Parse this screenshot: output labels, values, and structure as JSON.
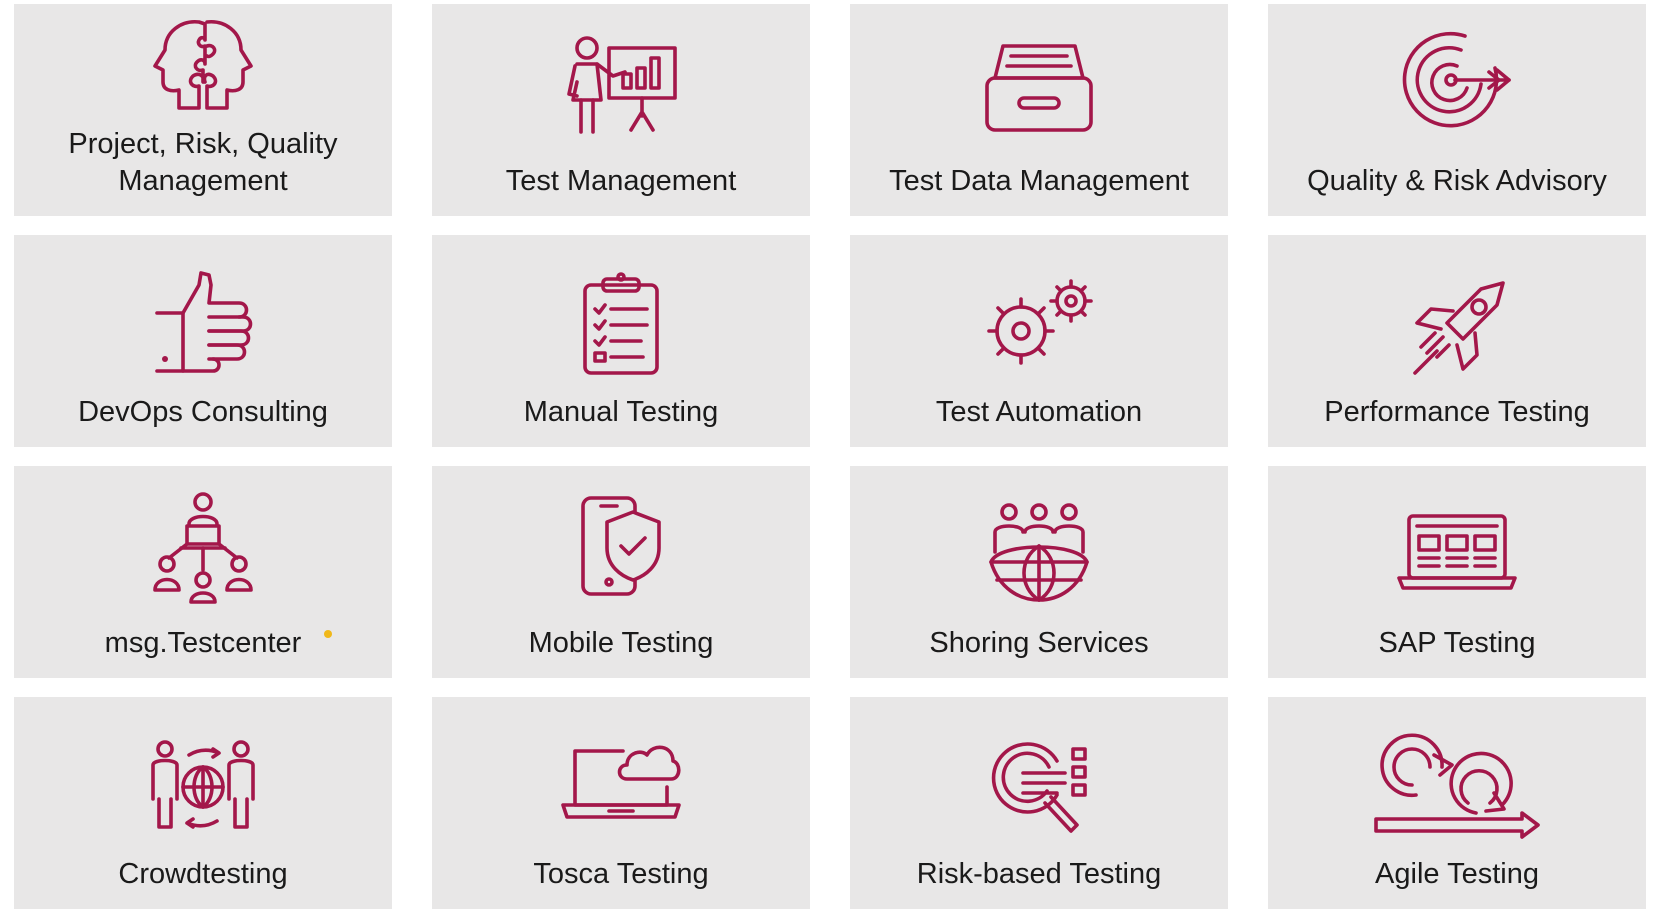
{
  "tiles": [
    {
      "label": "Project, Risk, Quality\nManagement",
      "icon": "puzzle-heads-icon"
    },
    {
      "label": "Test Management",
      "icon": "presenter-chart-icon"
    },
    {
      "label": "Test Data Management",
      "icon": "archive-drawer-icon"
    },
    {
      "label": "Quality & Risk Advisory",
      "icon": "target-arrow-icon"
    },
    {
      "label": "DevOps Consulting",
      "icon": "thumbs-up-icon"
    },
    {
      "label": "Manual Testing",
      "icon": "clipboard-checklist-icon"
    },
    {
      "label": "Test Automation",
      "icon": "gears-icon"
    },
    {
      "label": "Performance Testing",
      "icon": "rocket-icon"
    },
    {
      "label": "msg.Testcenter",
      "icon": "team-network-icon"
    },
    {
      "label": "Mobile Testing",
      "icon": "phone-shield-icon"
    },
    {
      "label": "Shoring Services",
      "icon": "people-globe-icon"
    },
    {
      "label": "SAP Testing",
      "icon": "laptop-icon"
    },
    {
      "label": "Crowdtesting",
      "icon": "people-globe-exchange-icon"
    },
    {
      "label": "Tosca Testing",
      "icon": "laptop-cloud-icon"
    },
    {
      "label": "Risk-based Testing",
      "icon": "magnifier-list-icon"
    },
    {
      "label": "Agile Testing",
      "icon": "agile-cycle-icon"
    }
  ],
  "colors": {
    "accent": "#a3174a",
    "tile_bg": "#e8e7e7",
    "text": "#1a1a1a"
  }
}
